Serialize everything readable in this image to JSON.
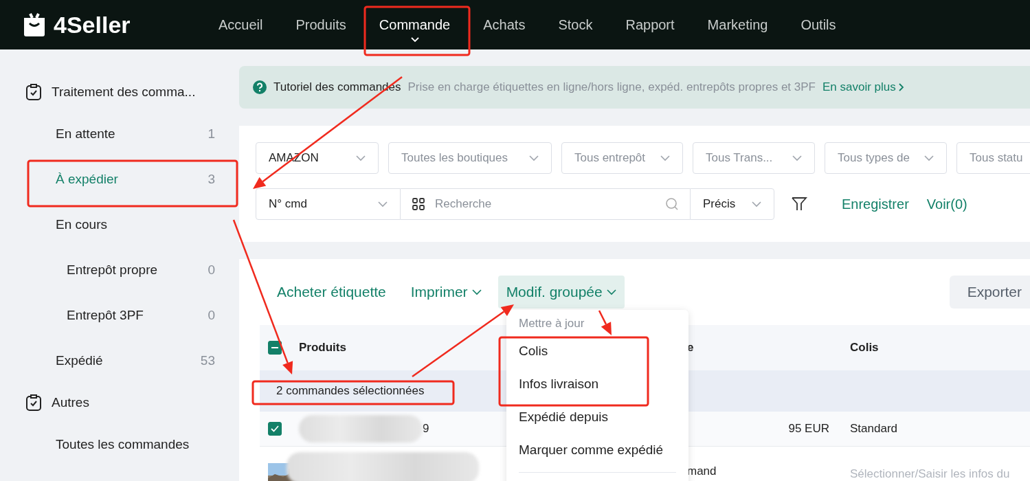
{
  "brand": {
    "name": "4Seller"
  },
  "nav": [
    {
      "label": "Accueil",
      "selected": false
    },
    {
      "label": "Produits",
      "selected": false
    },
    {
      "label": "Commande",
      "selected": true
    },
    {
      "label": "Achats",
      "selected": false
    },
    {
      "label": "Stock",
      "selected": false
    },
    {
      "label": "Rapport",
      "selected": false
    },
    {
      "label": "Marketing",
      "selected": false
    },
    {
      "label": "Outils",
      "selected": false
    }
  ],
  "sidebar": {
    "groups": [
      {
        "title": "Traitement des comma...",
        "items": [
          {
            "label": "En attente",
            "count": "1",
            "selected": false
          },
          {
            "label": "À expédier",
            "count": "3",
            "selected": true
          },
          {
            "label": "En cours",
            "selected": false,
            "children": [
              {
                "label": "Entrepôt propre",
                "count": "0",
                "selected": false
              },
              {
                "label": "Entrepôt 3PF",
                "count": "0",
                "selected": false
              }
            ]
          },
          {
            "label": "Expédié",
            "count": "53",
            "selected": false
          }
        ]
      },
      {
        "title": "Autres",
        "items": [
          {
            "label": "Toutes les commandes",
            "selected": false
          }
        ]
      }
    ]
  },
  "banner": {
    "title": "Tutoriel des commandes",
    "text": "Prise en charge étiquettes en ligne/hors ligne, expéd. entrepôts propres et 3PF",
    "link": "En savoir plus"
  },
  "filters": {
    "selects": [
      {
        "value": "AMAZON"
      },
      {
        "placeholder": "Toutes les boutiques"
      },
      {
        "placeholder": "Tous entrepôt"
      },
      {
        "placeholder": "Tous Trans..."
      },
      {
        "placeholder": "Tous types de"
      },
      {
        "placeholder": "Tous statu"
      }
    ],
    "search_type": "N° cmd",
    "search": {
      "placeholder": "Recherche"
    },
    "match": "Précis",
    "links": [
      "Enregistrer",
      "Voir(0)"
    ]
  },
  "toolbar": {
    "actions": [
      {
        "label": "Acheter étiquette",
        "caret": false,
        "selected": false
      },
      {
        "label": "Imprimer",
        "caret": true,
        "selected": false
      },
      {
        "label": "Modif. groupée",
        "caret": true,
        "selected": true
      }
    ],
    "export": "Exporter"
  },
  "table": {
    "header_checkbox": {
      "indeterminate": true
    },
    "columns": [
      "Produits",
      "e",
      "Colis"
    ],
    "selection_note": "2 commandes sélectionnées",
    "rows": [
      {
        "checked": true,
        "product": "9",
        "amount": "95 EUR",
        "colis": "Standard",
        "kind": "text"
      },
      {
        "kind": "picture",
        "column_3": "mand",
        "colis_field": {
          "placeholder": "Sélectionner/Saisir les infos du"
        }
      }
    ]
  },
  "menu": {
    "group": "Mettre à jour",
    "items": [
      "Colis",
      "Infos livraison",
      "Expédié depuis",
      "Marquer comme expédié"
    ]
  }
}
